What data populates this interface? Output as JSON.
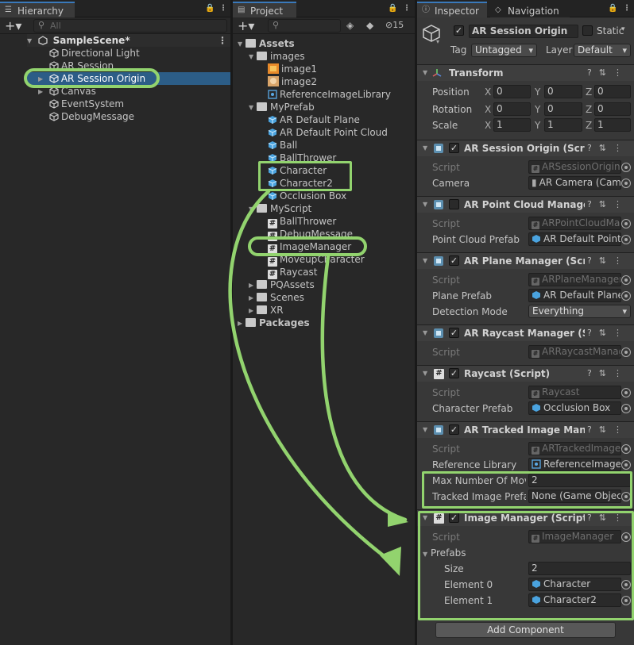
{
  "hierarchy": {
    "tab": "Hierarchy",
    "search_placeholder": "All",
    "scene": "SampleScene*",
    "items": [
      "Directional Light",
      "AR Session",
      "AR Session Origin",
      "Canvas",
      "EventSystem",
      "DebugMessage"
    ]
  },
  "project": {
    "tab": "Project",
    "hidden_count": "15",
    "assets": "Assets",
    "images_folder": "images",
    "images": [
      "image1",
      "image2",
      "ReferenceImageLibrary"
    ],
    "prefab_folder": "MyPrefab",
    "prefabs": [
      "AR Default Plane",
      "AR Default Point Cloud",
      "Ball",
      "BallThrower",
      "Character",
      "Character2",
      "Occlusion Box"
    ],
    "script_folder": "MyScript",
    "scripts": [
      "BallThrower",
      "DebugMessage",
      "ImageManager",
      "MoveupCharacter",
      "Raycast"
    ],
    "other_folders": [
      "PQAssets",
      "Scenes",
      "XR"
    ],
    "packages": "Packages"
  },
  "inspector": {
    "tabs": [
      "Inspector",
      "Navigation"
    ],
    "object_name": "AR Session Origin",
    "static_label": "Static",
    "tag_label": "Tag",
    "tag_value": "Untagged",
    "layer_label": "Layer",
    "layer_value": "Default",
    "transform": {
      "title": "Transform",
      "rows": [
        {
          "label": "Position",
          "x": "0",
          "y": "0",
          "z": "0"
        },
        {
          "label": "Rotation",
          "x": "0",
          "y": "0",
          "z": "0"
        },
        {
          "label": "Scale",
          "x": "1",
          "y": "1",
          "z": "1"
        }
      ]
    },
    "components": {
      "session_origin": {
        "title": "AR Session Origin (Script)",
        "script_label": "Script",
        "script": "ARSessionOrigin",
        "camera_label": "Camera",
        "camera": "AR Camera (Cam"
      },
      "point_cloud": {
        "title": "AR Point Cloud Manager (",
        "script_label": "Script",
        "script": "ARPointCloudMa",
        "prefab_label": "Point Cloud Prefab",
        "prefab": "AR Default Point"
      },
      "plane": {
        "title": "AR Plane Manager (Script",
        "script_label": "Script",
        "script": "ARPlaneManager",
        "prefab_label": "Plane Prefab",
        "prefab": "AR Default Plane",
        "mode_label": "Detection Mode",
        "mode": "Everything"
      },
      "raycast_mgr": {
        "title": "AR Raycast Manager (Scr",
        "script_label": "Script",
        "script": "ARRaycastManag"
      },
      "raycast": {
        "title": "Raycast (Script)",
        "script_label": "Script",
        "script": "Raycast",
        "prefab_label": "Character Prefab",
        "prefab": "Occlusion Box"
      },
      "tracked": {
        "title": "AR Tracked Image Manag",
        "script_label": "Script",
        "script": "ARTrackedImage",
        "lib_label": "Reference Library",
        "lib": "ReferenceImageL",
        "max_label": "Max Number Of Movi",
        "max": "2",
        "prefab_label": "Tracked Image Prefal",
        "prefab": "None (Game Object"
      },
      "image_manager": {
        "title": "Image Manager (Script)",
        "script_label": "Script",
        "script": "ImageManager",
        "prefabs_label": "Prefabs",
        "size_label": "Size",
        "size": "2",
        "el0_label": "Element 0",
        "el0": "Character",
        "el1_label": "Element 1",
        "el1": "Character2"
      }
    },
    "add_component": "Add Component"
  },
  "colors": {
    "highlight": "#92d36e",
    "selection": "#2c5d87",
    "panel": "#282828",
    "inspector": "#383838"
  }
}
